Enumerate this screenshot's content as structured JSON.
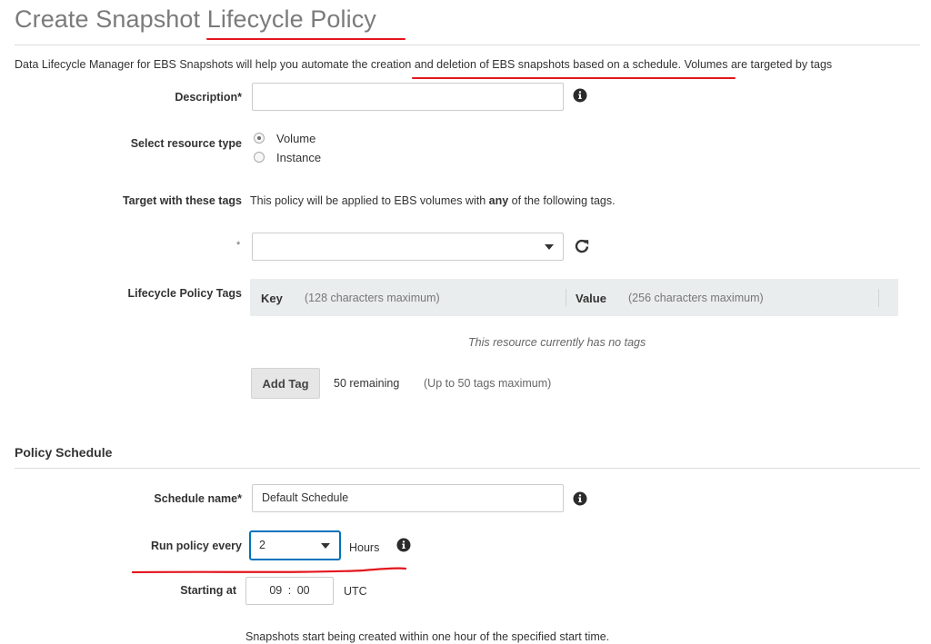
{
  "page_title": "Create Snapshot Lifecycle Policy",
  "intro_text": "Data Lifecycle Manager for EBS Snapshots will help you automate the creation and deletion of EBS snapshots based on a schedule. Volumes are targeted by tags",
  "description": {
    "label": "Description*",
    "value": ""
  },
  "resource_type": {
    "label": "Select resource type",
    "options": [
      {
        "label": "Volume",
        "selected": true
      },
      {
        "label": "Instance",
        "selected": false
      }
    ]
  },
  "target_tags": {
    "label": "Target with these tags",
    "text_before": "This policy will be applied to EBS volumes with ",
    "text_bold": "any",
    "text_after": " of the following tags.",
    "required_marker": "*",
    "select_value": ""
  },
  "lifecycle_tags": {
    "label": "Lifecycle Policy Tags",
    "key_header": "Key",
    "key_hint": "(128 characters maximum)",
    "value_header": "Value",
    "value_hint": "(256 characters maximum)",
    "empty_text": "This resource currently has no tags",
    "add_button": "Add Tag",
    "remaining": "50 remaining",
    "limit": "(Up to 50 tags maximum)"
  },
  "policy_schedule": {
    "title": "Policy Schedule",
    "schedule_name": {
      "label": "Schedule name*",
      "value": "Default Schedule"
    },
    "run_every": {
      "label": "Run policy every",
      "value": "2",
      "unit": "Hours"
    },
    "starting_at": {
      "label": "Starting at",
      "hour": "09",
      "separator": ":",
      "minute": "00",
      "timezone": "UTC"
    },
    "note": "Snapshots start being created within one hour of the specified start time."
  },
  "colors": {
    "annotation": "#e3161d",
    "focus": "#0073bb",
    "header_bg": "#eaeded"
  }
}
